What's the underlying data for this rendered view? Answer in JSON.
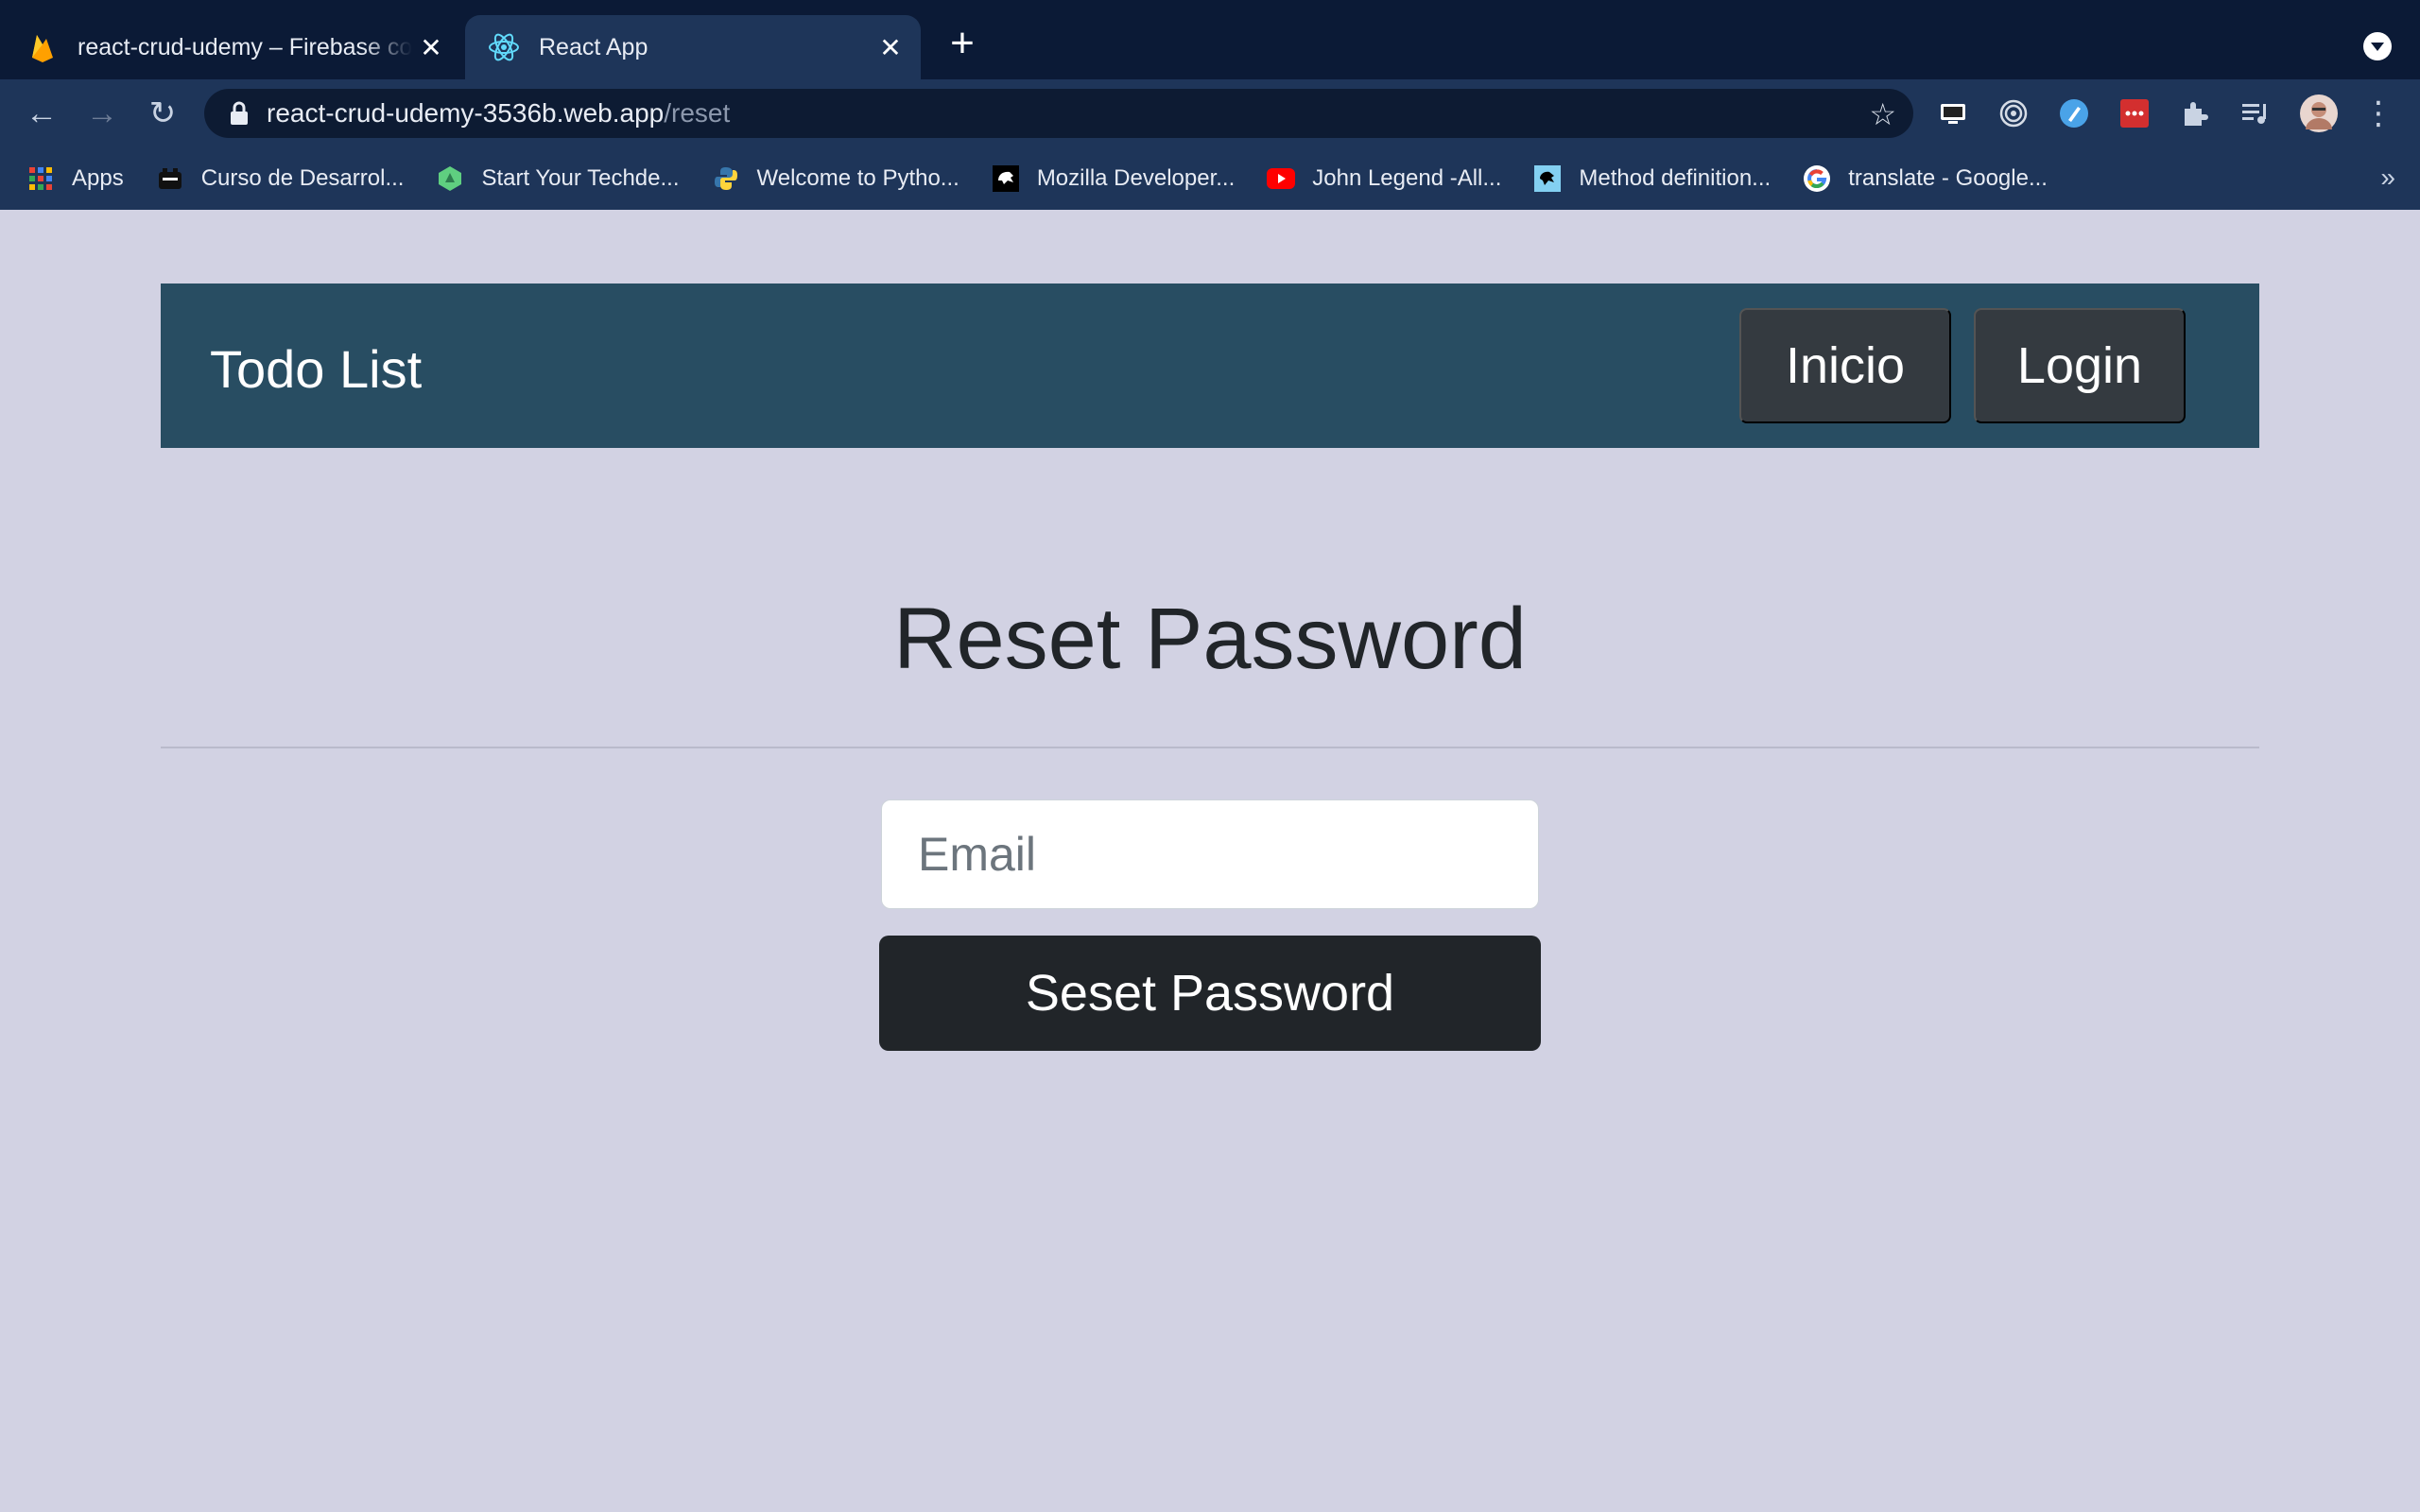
{
  "browser": {
    "tabs": [
      {
        "title": "react-crud-udemy – Firebase console",
        "icon": "firebase-icon",
        "active": false
      },
      {
        "title": "React App",
        "icon": "react-icon",
        "active": true
      }
    ],
    "url_host": "react-crud-udemy-3536b.web.app",
    "url_path": "/reset",
    "bookmarks": [
      {
        "label": "Apps",
        "icon": "apps-grid-icon"
      },
      {
        "label": "Curso de Desarrol...",
        "icon": "course-icon"
      },
      {
        "label": "Start Your Techde...",
        "icon": "techdegree-icon"
      },
      {
        "label": "Welcome to Pytho...",
        "icon": "python-icon"
      },
      {
        "label": "Mozilla Developer...",
        "icon": "mdn-icon"
      },
      {
        "label": "John Legend -All...",
        "icon": "youtube-icon"
      },
      {
        "label": "Method definition...",
        "icon": "method-icon"
      },
      {
        "label": "translate - Google...",
        "icon": "google-icon"
      }
    ],
    "bookmarks_more": "»"
  },
  "navbar": {
    "brand": "Todo List",
    "links": [
      "Inicio",
      "Login"
    ]
  },
  "main": {
    "heading": "Reset Password",
    "email_placeholder": "Email",
    "submit_label": "Seset Password"
  },
  "colors": {
    "page_bg": "#d2d2e3",
    "navbar_bg": "#284d62",
    "button_dark": "#212529",
    "nav_button": "#343a40"
  }
}
